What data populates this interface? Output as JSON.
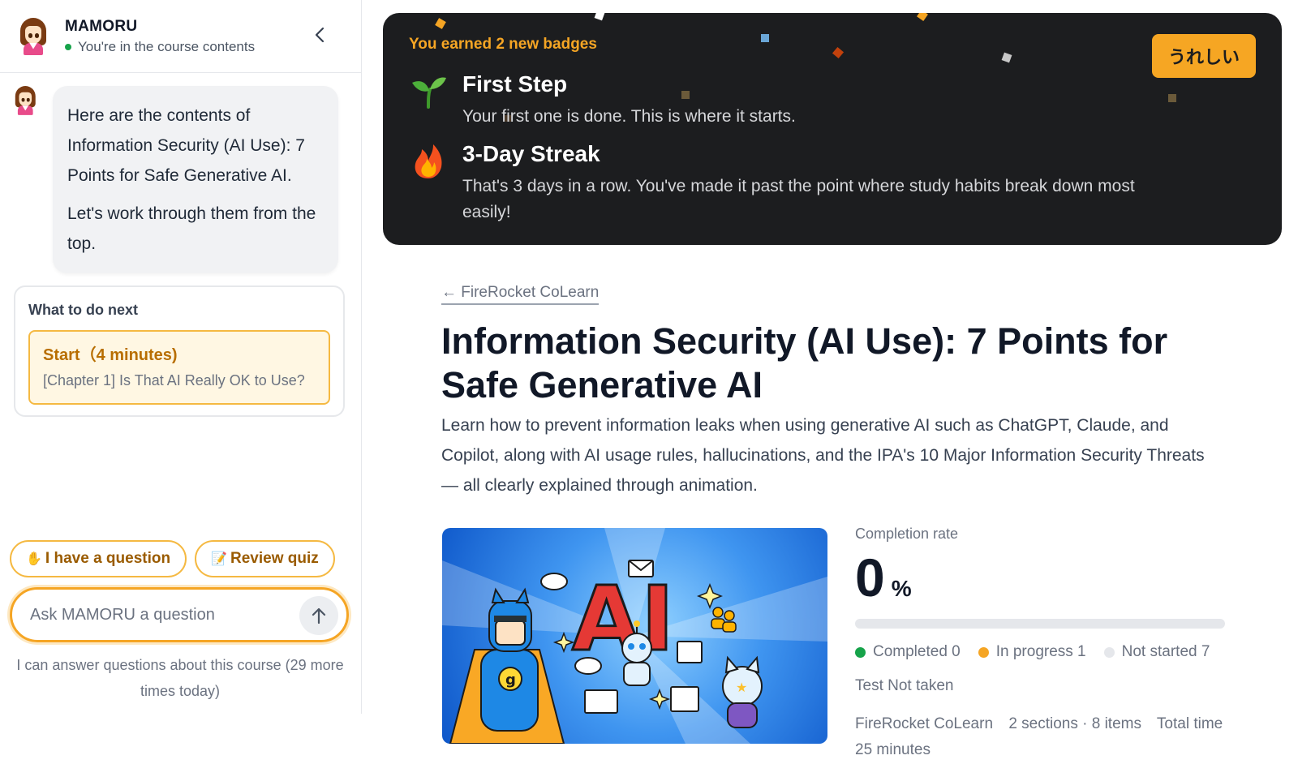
{
  "sidebar": {
    "assistant_name": "MAMORU",
    "status_text": "You're in the course contents",
    "message": {
      "line1": "Here are the contents of Information Security (AI Use): 7 Points for Safe Generative AI.",
      "line2": "Let's work through them from the top."
    },
    "next": {
      "title": "What to do next",
      "action_label": "Start（4 minutes)",
      "action_sub": "[Chapter 1] Is That AI Really OK to Use?"
    },
    "chips": [
      {
        "emoji": "✋",
        "label": "I have a question"
      },
      {
        "emoji": "📝",
        "label": "Review quiz"
      }
    ],
    "input_placeholder": "Ask MAMORU a question",
    "note": "I can answer questions about this course (29 more times today)"
  },
  "banner": {
    "heading": "You earned 2 new badges",
    "button_label": "うれしい",
    "badges": [
      {
        "icon": "sprout-icon",
        "title": "First Step",
        "desc": "Your first one is done. This is where it starts."
      },
      {
        "icon": "fire-icon",
        "title": "3-Day Streak",
        "desc": "That's 3 days in a row. You've made it past the point where study habits break down most easily!"
      }
    ]
  },
  "course": {
    "back_link": "← FireRocket CoLearn",
    "title": "Information Security (AI Use): 7 Points for Safe Generative AI",
    "description": "Learn how to prevent information leaks when using generative AI such as ChatGPT, Claude, and Copilot, along with AI usage rules, hallucinations, and the IPA's 10 Major Information Security Threats — all clearly explained through animation.",
    "thumbnail_text": "AI"
  },
  "stats": {
    "completion_label": "Completion rate",
    "completion_value": "0",
    "completion_unit": "%",
    "completion_fraction": 0,
    "legend": [
      {
        "label": "Completed 0",
        "color": "#16a34a"
      },
      {
        "label": "In progress 1",
        "color": "#f5a524"
      },
      {
        "label": "Not started 7",
        "color": "#e5e7eb"
      }
    ],
    "test_status": "Test Not taken",
    "provider": "FireRocket CoLearn",
    "sections": "2 sections · 8 items",
    "total_time": "Total time 25 minutes"
  },
  "colors": {
    "accent": "#f5a524",
    "banner_bg": "#1c1d1f"
  }
}
